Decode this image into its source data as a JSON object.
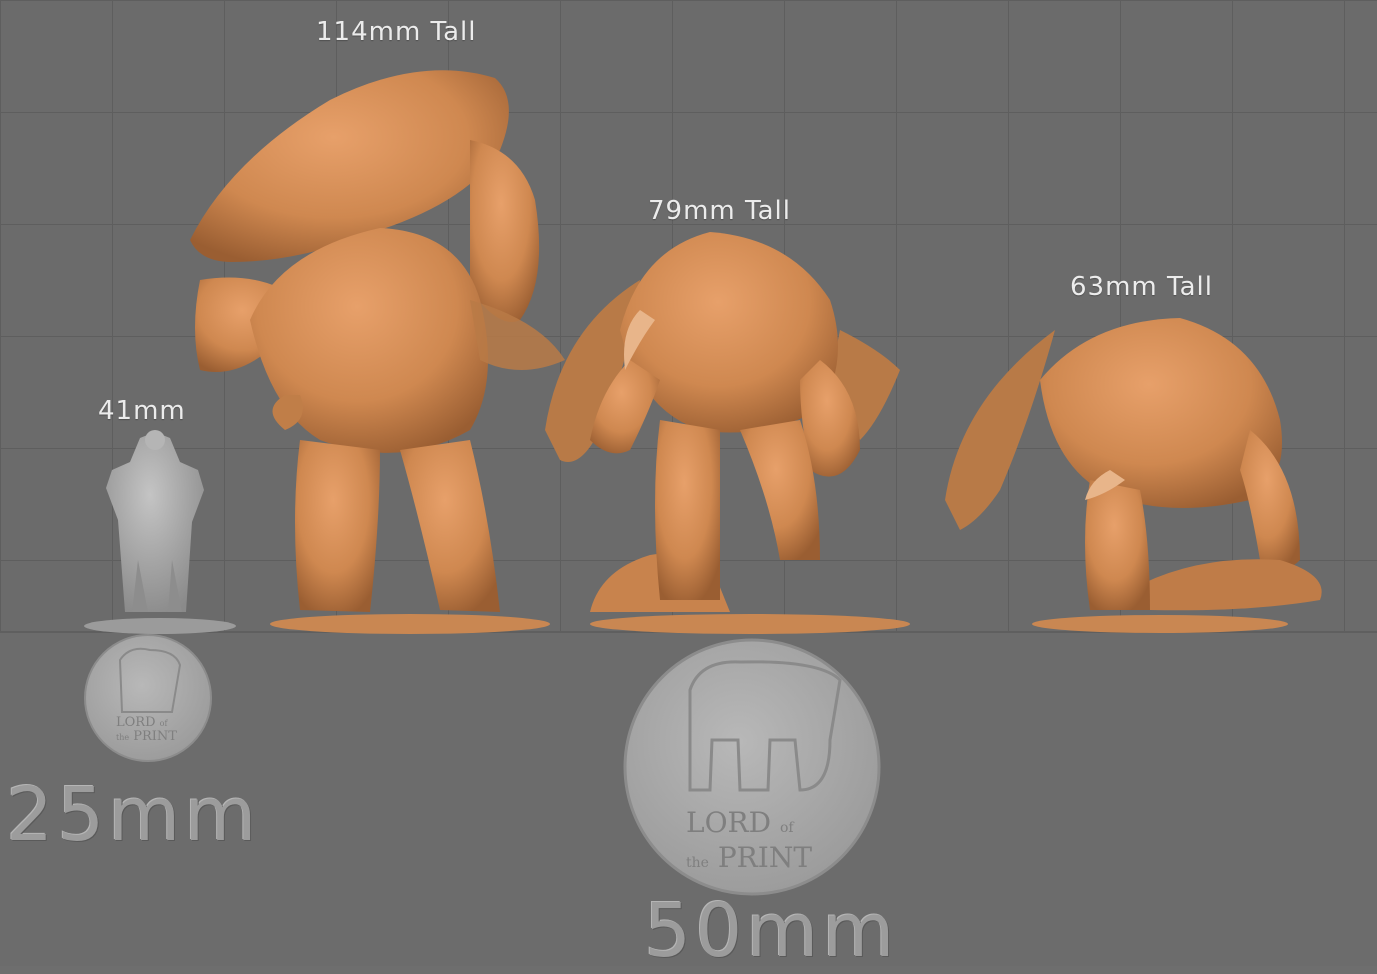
{
  "scene": {
    "background_color": "#6e6e6e",
    "model_color": "#d08a52",
    "reference_model_color": "#a9a9a9",
    "base_color": "#9e9e9e"
  },
  "labels": {
    "large_model_height": "114mm Tall",
    "medium_model_height": "79mm Tall",
    "small_model_height": "63mm Tall",
    "reference_height": "41mm"
  },
  "bases": {
    "small_base_size": "25mm",
    "large_base_size": "50mm"
  },
  "logo": {
    "line1": "LORD",
    "line2": "of",
    "line3": "the",
    "line4": "PRINT"
  }
}
